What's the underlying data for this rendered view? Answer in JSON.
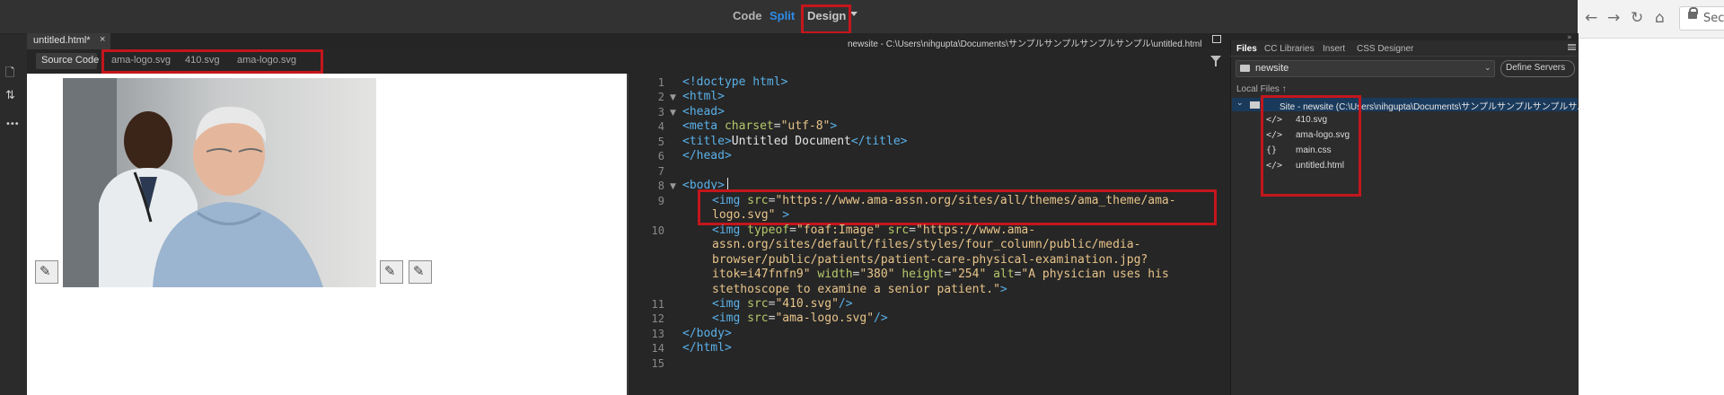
{
  "mode_bar": {
    "code_label": "Code",
    "split_label": "Split",
    "design_label": "Design"
  },
  "document": {
    "tab_label": "untitled.html*",
    "tab_close": "×",
    "path": "newsite - C:\\Users\\nihgupta\\Documents\\サンプルサンプルサンプルサンプル\\untitled.html"
  },
  "related_files": {
    "source_code_label": "Source Code",
    "files": [
      "ama-logo.svg",
      "410.svg",
      "ama-logo.svg"
    ]
  },
  "left_toolbar": {
    "file_icon": "file-icon",
    "sort_icon": "sort-icon",
    "more_label": "•••"
  },
  "design_view": {
    "image_alt": "A physician uses his stethoscope to examine a senior patient."
  },
  "code_view": {
    "line_numbers": [
      "1",
      "2",
      "3",
      "4",
      "5",
      "6",
      "7",
      "8",
      "9",
      "",
      "10",
      "",
      "",
      "",
      "",
      "11",
      "12",
      "13",
      "14",
      "15"
    ]
  },
  "files_panel": {
    "tabs": [
      "Files",
      "CC Libraries",
      "Insert",
      "CSS Designer"
    ],
    "site_name": "newsite",
    "define_servers_label": "Define Servers",
    "local_files_label": "Local Files ↑",
    "site_root_label": "Site - newsite (C:\\Users\\nihgupta\\Documents\\サンプルサンプルサンプルサ...",
    "files": [
      {
        "icon": "</>",
        "name": "410.svg"
      },
      {
        "icon": "</>",
        "name": "ama-logo.svg"
      },
      {
        "icon": "{}",
        "name": "main.css"
      },
      {
        "icon": "</>",
        "name": "untitled.html"
      }
    ]
  },
  "browser": {
    "omnibox_text": "Secu"
  },
  "colors": {
    "accent": "#2d8ceb",
    "highlight_box": "#c4161c",
    "code_bg": "#262626"
  }
}
